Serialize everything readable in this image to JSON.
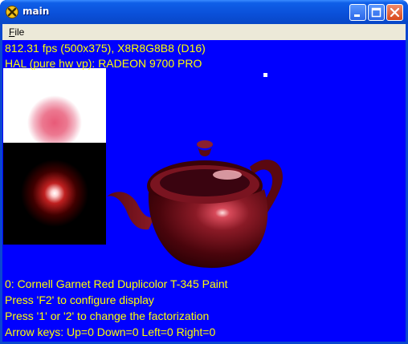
{
  "window": {
    "title": "main",
    "icon": "directx-x-icon",
    "buttons": [
      "minimize-button",
      "maximize-button",
      "close-button"
    ]
  },
  "menu": {
    "file_underlined": "F",
    "file_rest": "ile"
  },
  "hud": {
    "fps_line": "812.31 fps (500x375), X8R8G8B8 (D16)",
    "device_line": "HAL (pure hw vp): RADEON 9700 PRO",
    "material_line": "0: Cornell Garnet Red Duplicolor T-345 Paint",
    "help_f2": "Press 'F2' to configure display",
    "help_factor": "Press '1' or '2' to change the factorization",
    "help_arrows": "Arrow keys: Up=0 Down=0 Left=0 Right=0"
  },
  "colors": {
    "background": "#0000ff",
    "hud_text": "#ffff00",
    "teapot": "#6a0a14",
    "titlebar": "#0a4fd8"
  }
}
